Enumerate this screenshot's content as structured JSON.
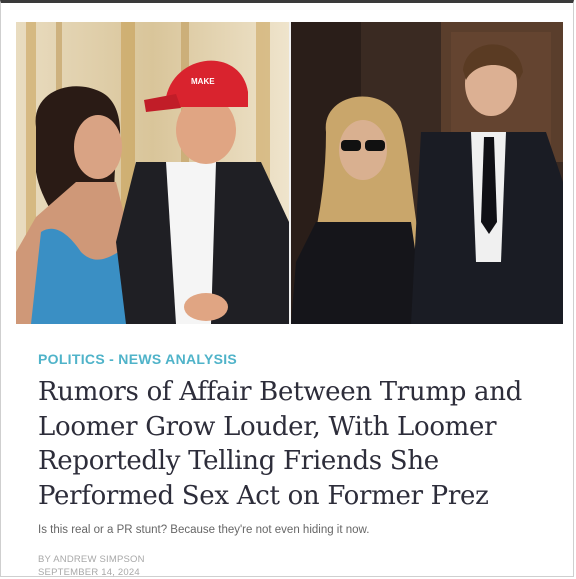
{
  "article": {
    "category": "POLITICS - NEWS ANALYSIS",
    "headline": "Rumors of Affair Between Trump and Loomer Grow Louder, With Loomer Reportedly Telling Friends She Performed Sex Act on Former Prez",
    "dek": "Is this real or a PR stunt? Because they're not even hiding it now.",
    "byline": "BY ANDREW SIMPSON",
    "date": "SEPTEMBER 14, 2024"
  },
  "colors": {
    "category": "#4fb3c9",
    "headline": "#2d2d3a",
    "dek": "#666666",
    "byline": "#a8a8a8"
  }
}
